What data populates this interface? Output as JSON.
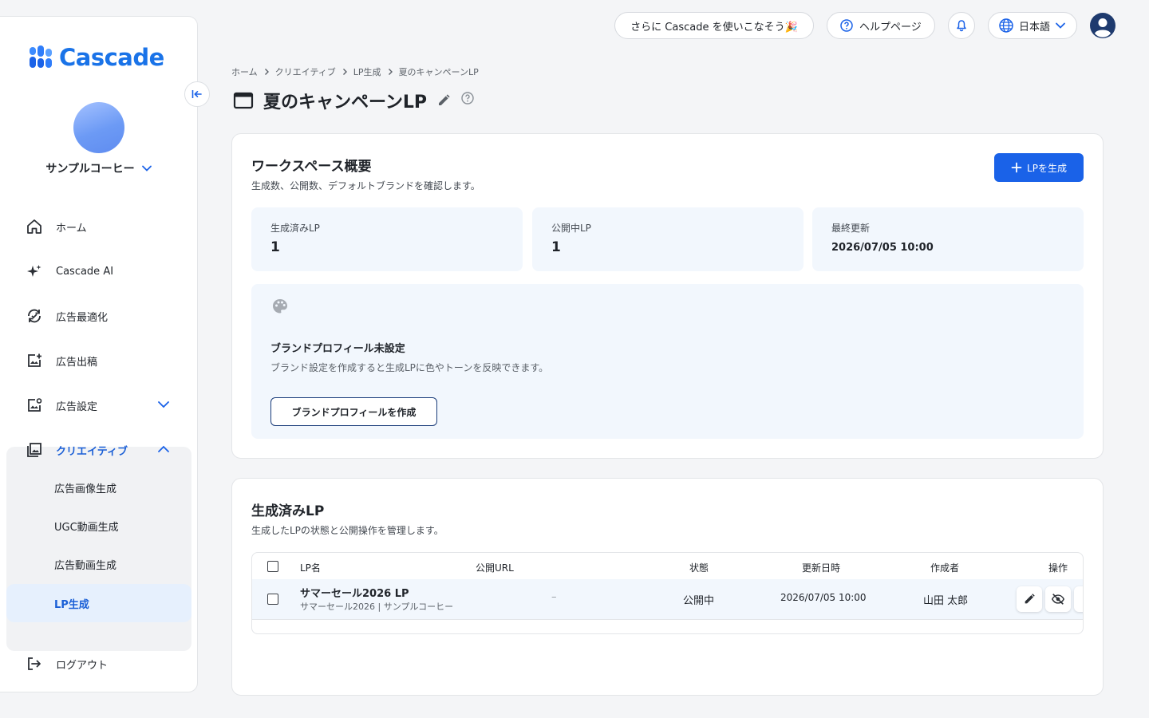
{
  "sidebar": {
    "logo": "Cascade",
    "org_name": "サンプルコーヒー",
    "nav": [
      {
        "label": "ホーム"
      },
      {
        "label": "Cascade AI"
      },
      {
        "label": "広告最適化"
      },
      {
        "label": "広告出稿"
      },
      {
        "label": "広告設定"
      },
      {
        "label": "クリエイティブ"
      }
    ],
    "creative_sub": [
      {
        "label": "広告画像生成"
      },
      {
        "label": "UGC動画生成"
      },
      {
        "label": "広告動画生成"
      },
      {
        "label": "LP生成"
      }
    ],
    "logout": "ログアウト"
  },
  "topbar": {
    "promo": "さらに Cascade を使いこなそう🎉",
    "help": "ヘルプページ",
    "language": "日本語"
  },
  "breadcrumb": [
    "ホーム",
    "クリエイティブ",
    "LP生成",
    "夏のキャンペーンLP"
  ],
  "page_title": "夏のキャンペーンLP",
  "overview": {
    "title": "ワークスペース概要",
    "desc": "生成数、公開数、デフォルトブランドを確認します。",
    "create_button": "LPを生成",
    "stats": [
      {
        "label": "生成済みLP",
        "value": "1"
      },
      {
        "label": "公開中LP",
        "value": "1"
      },
      {
        "label": "最終更新",
        "value": "2026/07/05 10:00"
      }
    ],
    "brand": {
      "title": "ブランドプロフィール未設定",
      "desc": "ブランド設定を作成すると生成LPに色やトーンを反映できます。",
      "button": "ブランドプロフィールを作成"
    }
  },
  "lp_list": {
    "title": "生成済みLP",
    "desc": "生成したLPの状態と公開操作を管理します。",
    "columns": {
      "name": "LP名",
      "url": "公開URL",
      "status": "状態",
      "updated": "更新日時",
      "author": "作成者",
      "actions": "操作"
    },
    "rows": [
      {
        "name": "サマーセール2026 LP",
        "sub": "サマーセール2026 | サンプルコーヒー",
        "url": "–",
        "status": "公開中",
        "updated": "2026/07/05 10:00",
        "author": "山田 太郎"
      }
    ]
  },
  "colors": {
    "accent": "#1a62e8",
    "active_text": "#1a5fd6",
    "panel_bg": "#f2f7fd"
  }
}
